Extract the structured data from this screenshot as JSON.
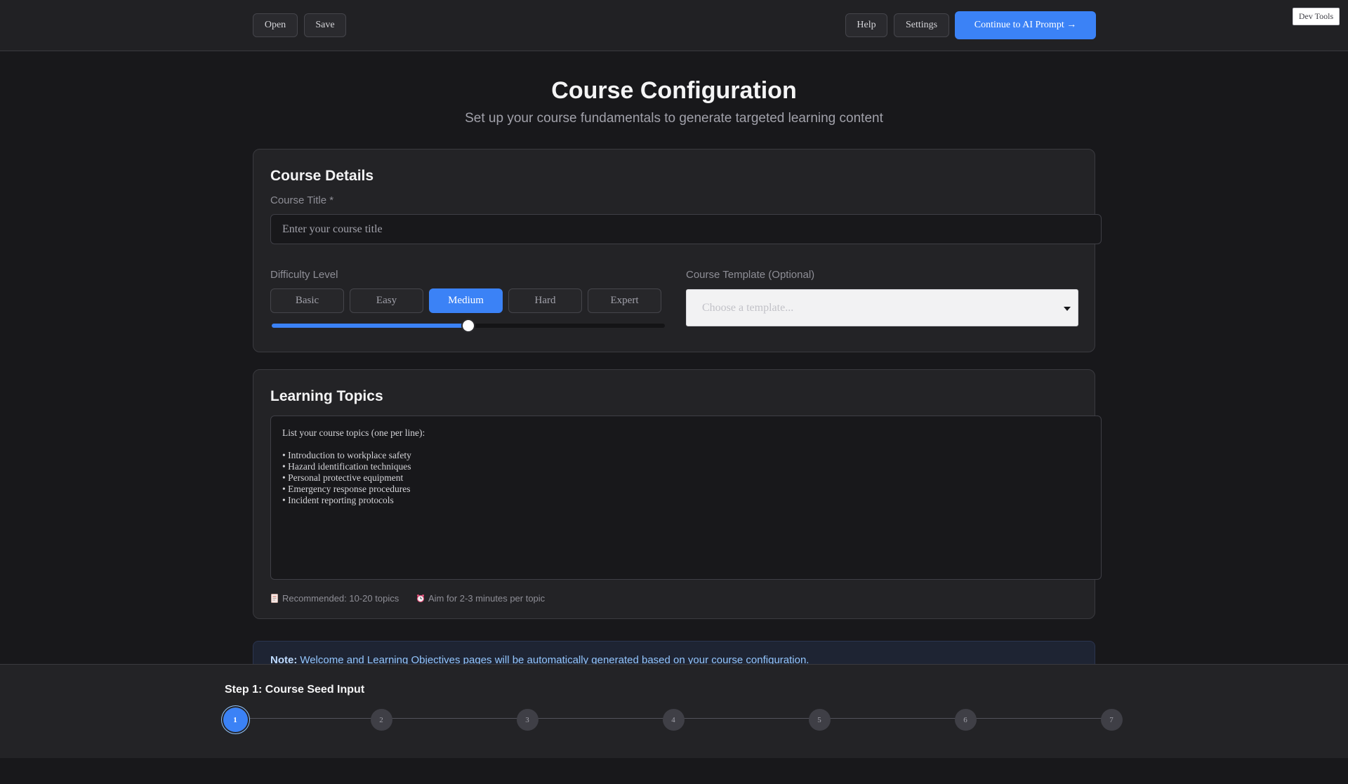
{
  "toolbar": {
    "open_label": "Open",
    "save_label": "Save",
    "help_label": "Help",
    "settings_label": "Settings",
    "continue_label": "Continue to AI Prompt →",
    "devtools_label": "Dev Tools"
  },
  "header": {
    "title": "Course Configuration",
    "subtitle": "Set up your course fundamentals to generate targeted learning content"
  },
  "course_details": {
    "title": "Course Details",
    "course_title_label": "Course Title *",
    "course_title_placeholder": "Enter your course title",
    "difficulty_label": "Difficulty Level",
    "difficulty_options": [
      "Basic",
      "Easy",
      "Medium",
      "Hard",
      "Expert"
    ],
    "difficulty_selected": "Medium",
    "difficulty_slider_fraction": 0.5,
    "template_label": "Course Template (Optional)",
    "template_placeholder": "Choose a template..."
  },
  "learning_topics": {
    "title": "Learning Topics",
    "textarea_content": "List your course topics (one per line):\n\n• Introduction to workplace safety\n• Hazard identification techniques\n• Personal protective equipment\n• Emergency response procedures\n• Incident reporting protocols",
    "hint_recommended": "Recommended: 10-20 topics",
    "hint_time": "Aim for 2-3 minutes per topic"
  },
  "note": {
    "label": "Note:",
    "text": "Welcome and Learning Objectives pages will be automatically generated based on your course configuration."
  },
  "progress": {
    "title": "Step 1: Course Seed Input",
    "current_step": 1,
    "steps": [
      "1",
      "2",
      "3",
      "4",
      "5",
      "6",
      "7"
    ]
  },
  "colors": {
    "accent": "#3b82f6",
    "background": "#18181b",
    "card": "#232326"
  }
}
